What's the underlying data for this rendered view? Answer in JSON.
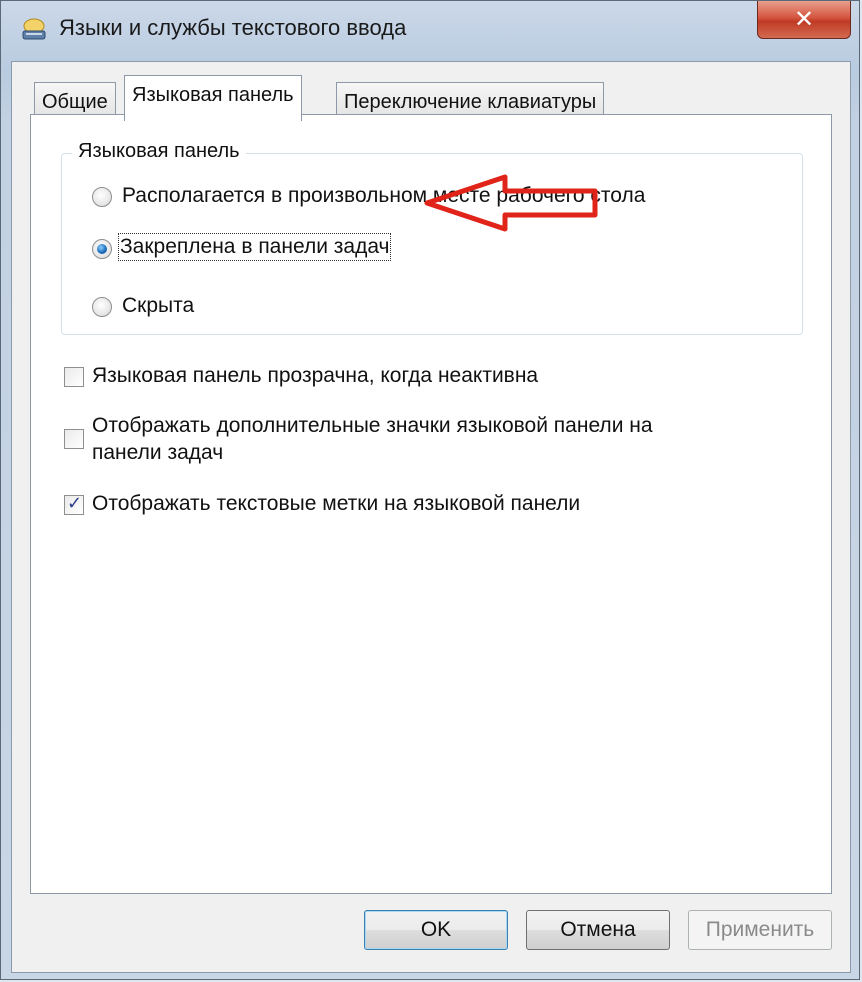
{
  "window": {
    "title": "Языки и службы текстового ввода",
    "close_symbol": "✕",
    "icon": "keyboard-icon"
  },
  "tabs": [
    {
      "label": "Общие",
      "active": false
    },
    {
      "label": "Языковая панель",
      "active": true
    },
    {
      "label": "Переключение клавиатуры",
      "active": false
    }
  ],
  "language_bar_group": {
    "title": "Языковая панель",
    "options": [
      {
        "label": "Располагается в произвольном месте рабочего стола",
        "selected": false
      },
      {
        "label": "Закреплена в панели задач",
        "selected": true
      },
      {
        "label": "Скрыта",
        "selected": false
      }
    ]
  },
  "checkboxes": [
    {
      "label": "Языковая панель прозрачна, когда неактивна",
      "checked": false
    },
    {
      "label_line1": "Отображать дополнительные значки языковой панели на",
      "label_line2": "панели задач",
      "checked": false
    },
    {
      "label": "Отображать текстовые метки на языковой панели",
      "checked": true
    }
  ],
  "annotation": {
    "icon": "red-arrow-icon",
    "color": "#e0241a"
  },
  "buttons": {
    "ok": "OK",
    "cancel": "Отмена",
    "apply": "Применить"
  }
}
